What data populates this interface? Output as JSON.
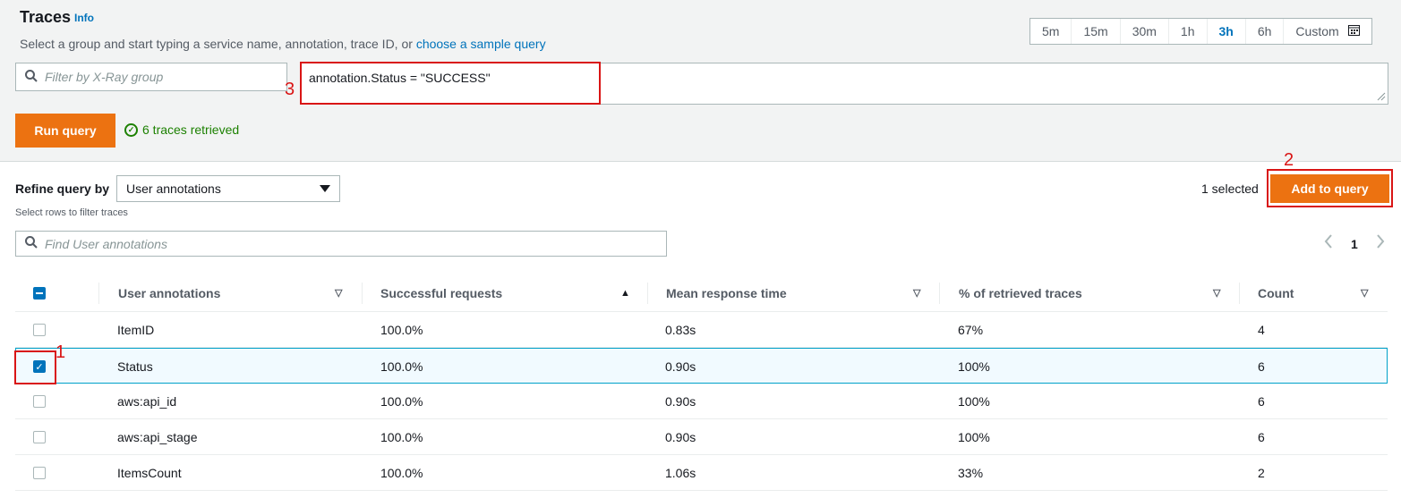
{
  "header": {
    "title": "Traces",
    "info_label": "Info",
    "subtitle_text": "Select a group and start typing a service name, annotation, trace ID, or ",
    "sample_query_link": "choose a sample query"
  },
  "time_range": {
    "options": [
      "5m",
      "15m",
      "30m",
      "1h",
      "3h",
      "6h",
      "Custom"
    ],
    "active": "3h"
  },
  "group_filter": {
    "placeholder": "Filter by X-Ray group"
  },
  "query": {
    "value": "annotation.Status = \"SUCCESS\""
  },
  "run_query": {
    "label": "Run query"
  },
  "status": {
    "text": "6 traces retrieved",
    "check": "✓"
  },
  "refine": {
    "label": "Refine query by",
    "selected_option": "User annotations",
    "hint": "Select rows to filter traces",
    "selected_count": "1 selected",
    "add_button": "Add to query",
    "find_placeholder": "Find User annotations"
  },
  "pagination": {
    "current_page": "1"
  },
  "table": {
    "headers": [
      "User annotations",
      "Successful requests",
      "Mean response time",
      "% of retrieved traces",
      "Count"
    ],
    "rows": [
      {
        "annotation": "ItemID",
        "success": "100.0%",
        "mean": "0.83s",
        "percent": "67%",
        "count": "4",
        "checked": false
      },
      {
        "annotation": "Status",
        "success": "100.0%",
        "mean": "0.90s",
        "percent": "100%",
        "count": "6",
        "checked": true
      },
      {
        "annotation": "aws:api_id",
        "success": "100.0%",
        "mean": "0.90s",
        "percent": "100%",
        "count": "6",
        "checked": false
      },
      {
        "annotation": "aws:api_stage",
        "success": "100.0%",
        "mean": "0.90s",
        "percent": "100%",
        "count": "6",
        "checked": false
      },
      {
        "annotation": "ItemsCount",
        "success": "100.0%",
        "mean": "1.06s",
        "percent": "33%",
        "count": "2",
        "checked": false
      }
    ]
  },
  "annotations": {
    "step1": "1",
    "step2": "2",
    "step3": "3",
    "color": "#d91515"
  },
  "colors": {
    "accent": "#ec7211",
    "link": "#0073bb",
    "success": "#1d8102"
  },
  "icons": {
    "search": "search-icon",
    "calendar": "calendar-icon",
    "check": "check-circle-icon"
  }
}
